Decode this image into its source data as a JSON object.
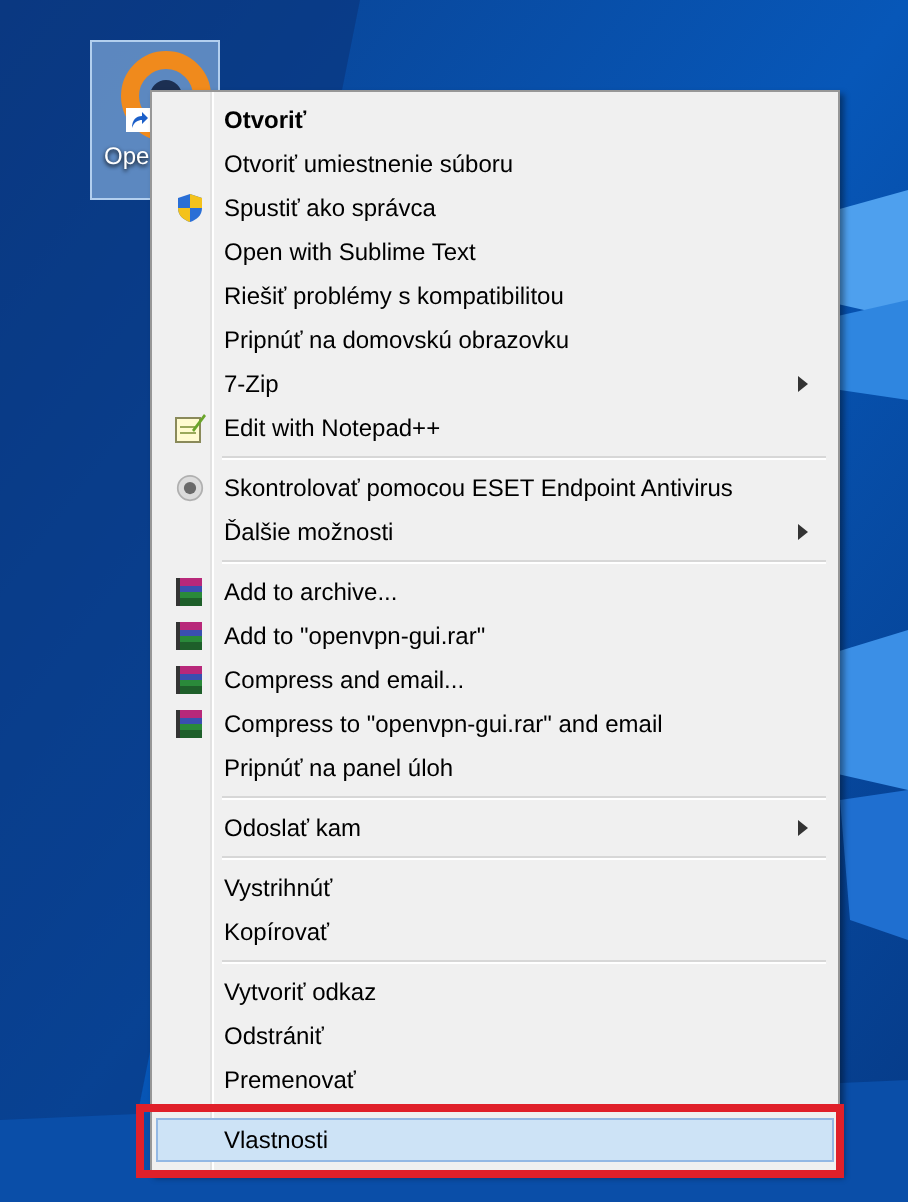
{
  "desktop_icon": {
    "label": "Ope",
    "selected": true
  },
  "menu": {
    "groups": [
      [
        {
          "label": "Otvoriť",
          "kind": "plain",
          "default": true,
          "submenu": false,
          "selected": false,
          "outlined": false
        },
        {
          "label": "Otvoriť umiestnenie súboru",
          "kind": "plain",
          "default": false,
          "submenu": false,
          "selected": false,
          "outlined": false
        },
        {
          "label": "Spustiť ako správca",
          "kind": "shield",
          "default": false,
          "submenu": false,
          "selected": false,
          "outlined": false
        },
        {
          "label": "Open with Sublime Text",
          "kind": "plain",
          "default": false,
          "submenu": false,
          "selected": false,
          "outlined": false
        },
        {
          "label": "Riešiť problémy s kompatibilitou",
          "kind": "plain",
          "default": false,
          "submenu": false,
          "selected": false,
          "outlined": false
        },
        {
          "label": "Pripnúť na domovskú obrazovku",
          "kind": "plain",
          "default": false,
          "submenu": false,
          "selected": false,
          "outlined": false
        },
        {
          "label": "7-Zip",
          "kind": "plain",
          "default": false,
          "submenu": true,
          "selected": false,
          "outlined": false
        },
        {
          "label": "Edit with Notepad++",
          "kind": "notepad",
          "default": false,
          "submenu": false,
          "selected": false,
          "outlined": false
        }
      ],
      [
        {
          "label": "Skontrolovať pomocou ESET Endpoint Antivirus",
          "kind": "eset",
          "default": false,
          "submenu": false,
          "selected": false,
          "outlined": false
        },
        {
          "label": "Ďalšie možnosti",
          "kind": "plain",
          "default": false,
          "submenu": true,
          "selected": false,
          "outlined": false
        }
      ],
      [
        {
          "label": "Add to archive...",
          "kind": "archive",
          "default": false,
          "submenu": false,
          "selected": false,
          "outlined": false
        },
        {
          "label": "Add to \"openvpn-gui.rar\"",
          "kind": "archive",
          "default": false,
          "submenu": false,
          "selected": false,
          "outlined": false
        },
        {
          "label": "Compress and email...",
          "kind": "archive",
          "default": false,
          "submenu": false,
          "selected": false,
          "outlined": false
        },
        {
          "label": "Compress to \"openvpn-gui.rar\" and email",
          "kind": "archive",
          "default": false,
          "submenu": false,
          "selected": false,
          "outlined": false
        },
        {
          "label": "Pripnúť na panel úloh",
          "kind": "plain",
          "default": false,
          "submenu": false,
          "selected": false,
          "outlined": false
        }
      ],
      [
        {
          "label": "Odoslať kam",
          "kind": "plain",
          "default": false,
          "submenu": true,
          "selected": false,
          "outlined": false
        }
      ],
      [
        {
          "label": "Vystrihnúť",
          "kind": "plain",
          "default": false,
          "submenu": false,
          "selected": false,
          "outlined": false
        },
        {
          "label": "Kopírovať",
          "kind": "plain",
          "default": false,
          "submenu": false,
          "selected": false,
          "outlined": false
        }
      ],
      [
        {
          "label": "Vytvoriť odkaz",
          "kind": "plain",
          "default": false,
          "submenu": false,
          "selected": false,
          "outlined": false
        },
        {
          "label": "Odstrániť",
          "kind": "plain",
          "default": false,
          "submenu": false,
          "selected": false,
          "outlined": false
        },
        {
          "label": "Premenovať",
          "kind": "plain",
          "default": false,
          "submenu": false,
          "selected": false,
          "outlined": false
        }
      ],
      [
        {
          "label": "Vlastnosti",
          "kind": "plain",
          "default": false,
          "submenu": false,
          "selected": true,
          "outlined": true
        }
      ]
    ]
  }
}
